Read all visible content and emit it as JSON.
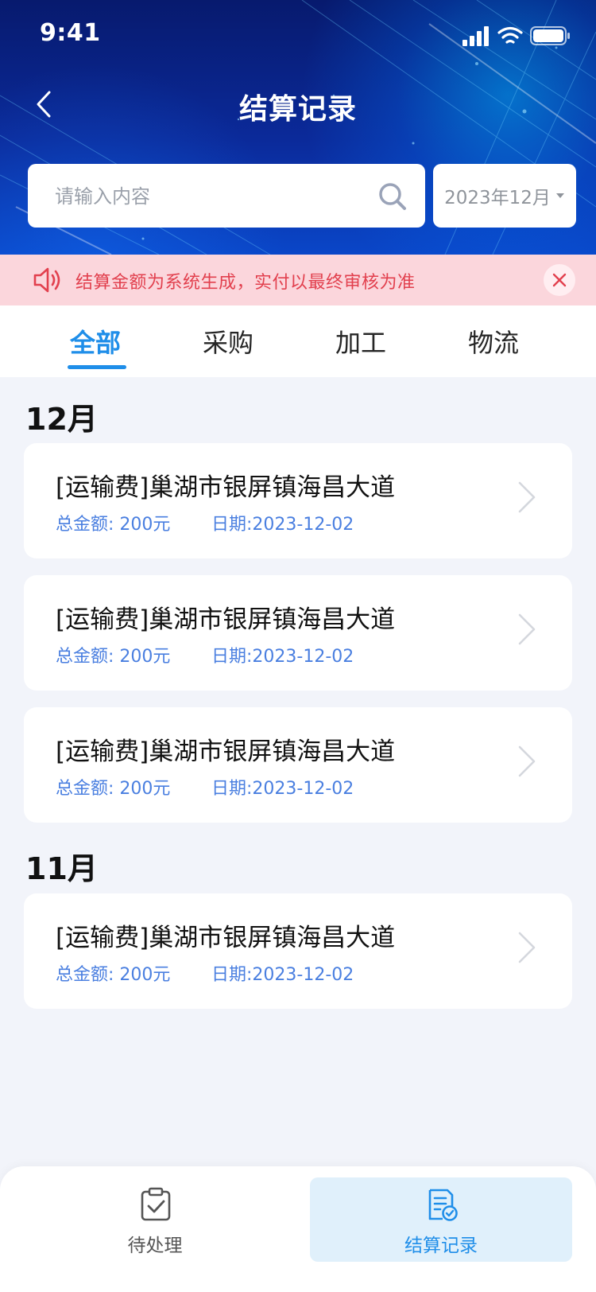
{
  "status_bar": {
    "time": "9:41"
  },
  "header": {
    "title": "结算记录"
  },
  "search": {
    "placeholder": "请输入内容",
    "date_value": "2023年12月"
  },
  "notice": {
    "text": "结算金额为系统生成，实付以最终审核为准"
  },
  "tabs": [
    {
      "label": "全部",
      "active": true
    },
    {
      "label": "采购",
      "active": false
    },
    {
      "label": "加工",
      "active": false
    },
    {
      "label": "物流",
      "active": false
    }
  ],
  "groups": [
    {
      "title": "12月",
      "records": [
        {
          "title": "[运输费]巢湖市银屏镇海昌大道",
          "amount": "总金额: 200元",
          "date": "日期:2023-12-02"
        },
        {
          "title": "[运输费]巢湖市银屏镇海昌大道",
          "amount": "总金额: 200元",
          "date": "日期:2023-12-02"
        },
        {
          "title": "[运输费]巢湖市银屏镇海昌大道",
          "amount": "总金额: 200元",
          "date": "日期:2023-12-02"
        }
      ]
    },
    {
      "title": "11月",
      "records": [
        {
          "title": "[运输费]巢湖市银屏镇海昌大道",
          "amount": "总金额: 200元",
          "date": "日期:2023-12-02"
        }
      ]
    }
  ],
  "bottom_nav": [
    {
      "label": "待处理",
      "icon": "clipboard-check-icon",
      "active": false
    },
    {
      "label": "结算记录",
      "icon": "document-check-icon",
      "active": true
    }
  ],
  "colors": {
    "accent": "#1f8ee9",
    "notice_bg": "#fbd6dc",
    "notice_text": "#e2404e",
    "info_text": "#4a7fe0"
  }
}
